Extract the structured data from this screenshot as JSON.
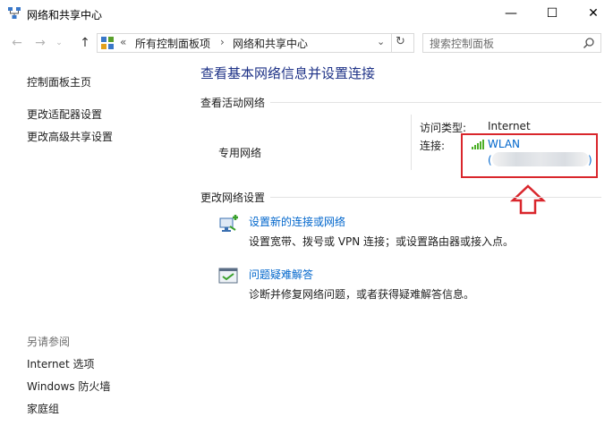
{
  "window": {
    "title": "网络和共享中心"
  },
  "titlebar": {
    "minimize_glyph": "—",
    "maximize_glyph": "☐",
    "close_glyph": "✕"
  },
  "breadcrumb": {
    "prefix": "«",
    "items": [
      "所有控制面板项",
      "网络和共享中心"
    ],
    "separator": "›"
  },
  "search": {
    "placeholder": "搜索控制面板"
  },
  "sidebar": {
    "items": [
      {
        "label": "控制面板主页"
      },
      {
        "label": "更改适配器设置"
      },
      {
        "label": "更改高级共享设置"
      }
    ],
    "see_also": {
      "heading": "另请参阅",
      "items": [
        {
          "label": "Internet 选项"
        },
        {
          "label": "Windows 防火墙"
        },
        {
          "label": "家庭组"
        }
      ]
    }
  },
  "main": {
    "heading": "查看基本网络信息并设置连接",
    "active_networks": {
      "title": "查看活动网络",
      "network_type": "专用网络",
      "access_type_label": "访问类型:",
      "access_type_value": "Internet",
      "connections_label": "连接:",
      "connection_name": "WLAN",
      "connection_detail_open": "(",
      "connection_detail_close": ")"
    },
    "change_settings": {
      "title": "更改网络设置",
      "items": [
        {
          "link": "设置新的连接或网络",
          "desc": "设置宽带、拨号或 VPN 连接；或设置路由器或接入点。",
          "icon": "network-setup-icon"
        },
        {
          "link": "问题疑难解答",
          "desc": "诊断并修复网络问题，或者获得疑难解答信息。",
          "icon": "troubleshoot-icon"
        }
      ]
    }
  },
  "colors": {
    "accent": "#0066cc",
    "heading": "#1e3287",
    "annotation": "#d9262c"
  }
}
